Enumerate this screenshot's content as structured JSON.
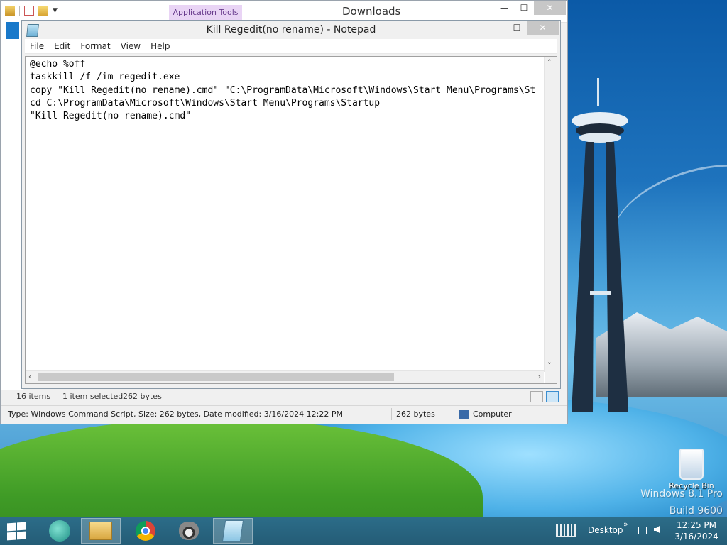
{
  "explorer": {
    "title": "Downloads",
    "context_tab": "Application Tools",
    "status": {
      "items_count": "16 items",
      "selected": "1 item selected",
      "selected_size": "262 bytes"
    },
    "details_bar": {
      "info": "Type: Windows Command Script, Size: 262 bytes, Date modified: 3/16/2024 12:22 PM",
      "size": "262 bytes",
      "location": "Computer"
    }
  },
  "notepad": {
    "title": "Kill Regedit(no rename) - Notepad",
    "menu": [
      "File",
      "Edit",
      "Format",
      "View",
      "Help"
    ],
    "content": "@echo %off\ntaskkill /f /im regedit.exe\ncopy \"Kill Regedit(no rename).cmd\" \"C:\\ProgramData\\Microsoft\\Windows\\Start Menu\\Programs\\St\ncd C:\\ProgramData\\Microsoft\\Windows\\Start Menu\\Programs\\Startup\n\"Kill Regedit(no rename).cmd\"",
    "scroll_position": 0.0
  },
  "window_controls": {
    "minimize": "—",
    "maximize": "☐",
    "close": "✕"
  },
  "desktop": {
    "recycle_bin_label": "Recycle Bin",
    "watermark_line1": "Windows 8.1 Pro",
    "watermark_line2": "Build 9600"
  },
  "taskbar": {
    "items": [
      "start-icon",
      "ie-edge-icon",
      "file-explorer-icon",
      "chrome-icon",
      "raccoon-app-icon",
      "notepad-icon"
    ],
    "desktop_label": "Desktop",
    "chevron": "»",
    "time": "12:25 PM",
    "date": "3/16/2024"
  },
  "colors": {
    "taskbar": "#2c6d89",
    "context_tab_bg": "#e9d4f5",
    "explorer_accent": "#1979ca"
  }
}
